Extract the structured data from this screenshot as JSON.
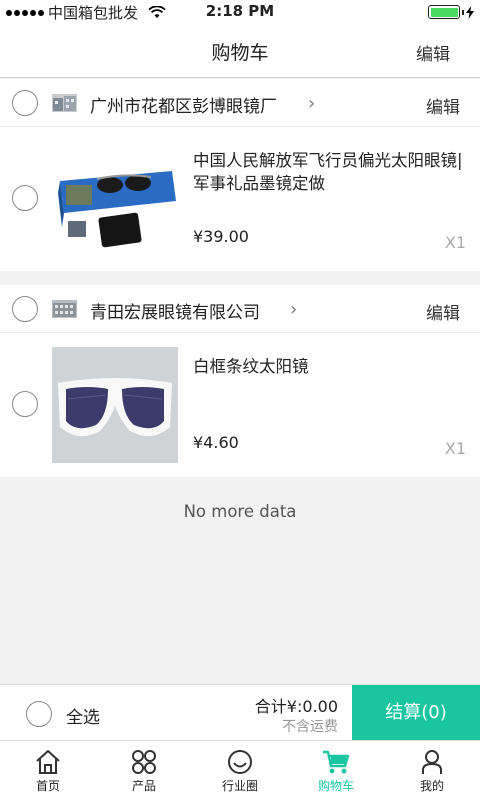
{
  "status_bar": {
    "carrier": "中国箱包批发",
    "time": "2:18 PM"
  },
  "nav": {
    "title": "购物车",
    "edit": "编辑"
  },
  "shops": [
    {
      "name": "广州市花都区彭博眼镜厂",
      "edit": "编辑",
      "items": [
        {
          "title": "中国人民解放军飞行员偏光太阳眼镜|军事礼品墨镜定做",
          "price": "¥39.00",
          "qty": "X1"
        }
      ]
    },
    {
      "name": "青田宏展眼镜有限公司",
      "edit": "编辑",
      "items": [
        {
          "title": "白框条纹太阳镜",
          "price": "¥4.60",
          "qty": "X1"
        }
      ]
    }
  ],
  "no_more": "No more data",
  "checkout": {
    "select_all": "全选",
    "total": "合计¥:0.00",
    "shipping": "不含运费",
    "pay": "结算(0)"
  },
  "tabs": [
    {
      "label": "首页",
      "icon": "home-icon",
      "active": false
    },
    {
      "label": "产品",
      "icon": "grid-icon",
      "active": false
    },
    {
      "label": "行业圈",
      "icon": "smile-icon",
      "active": false
    },
    {
      "label": "购物车",
      "icon": "cart-icon",
      "active": true
    },
    {
      "label": "我的",
      "icon": "user-icon",
      "active": false
    }
  ],
  "colors": {
    "accent": "#1ac6a0",
    "battery": "#4cd964"
  }
}
